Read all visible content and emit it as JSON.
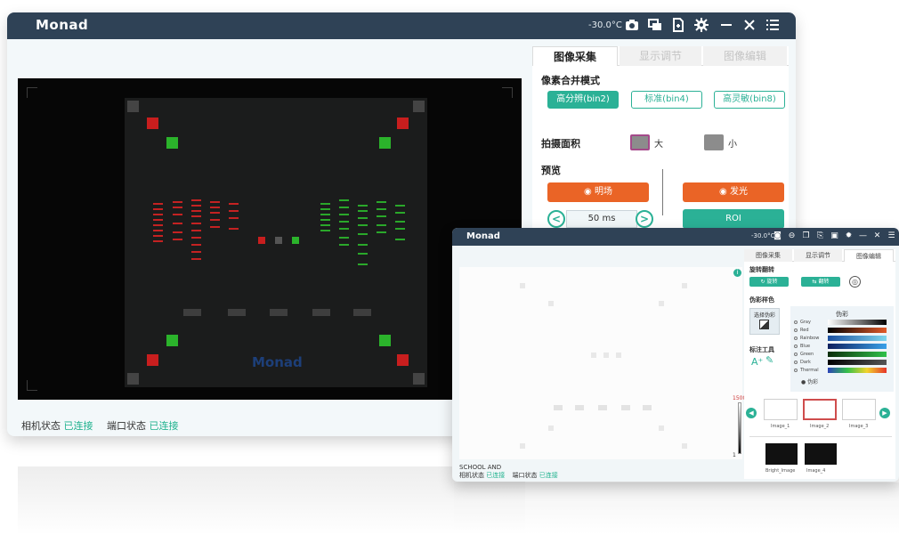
{
  "main_window": {
    "title": "Monad",
    "temperature": "-30.0°C",
    "icons": [
      "camera-icon",
      "windows-icon",
      "export-icon",
      "gear-icon",
      "minimize-icon",
      "close-icon",
      "list-icon"
    ],
    "tabs": [
      {
        "label": "图像采集",
        "active": true
      },
      {
        "label": "显示调节",
        "active": false
      },
      {
        "label": "图像编辑",
        "active": false
      }
    ],
    "binning": {
      "title": "像素合并模式",
      "options": [
        {
          "label": "高分辨(bin2)",
          "active": true
        },
        {
          "label": "标准(bin4)",
          "active": false
        },
        {
          "label": "高灵敏(bin8)",
          "active": false
        }
      ]
    },
    "area": {
      "title": "拍摄面积",
      "large": "大",
      "small": "小"
    },
    "preview": {
      "title": "预览",
      "brightfield": "明场",
      "chemi": "发光",
      "exposure": "50 ms",
      "roi": "ROI",
      "minus": "<",
      "plus": ">"
    },
    "plate_logo": "Monad",
    "status": {
      "camera_label": "相机状态",
      "camera_value": "已连接",
      "port_label": "端口状态",
      "port_value": "已连接"
    }
  },
  "second_window": {
    "title": "Monad",
    "temperature": "-30.0°C",
    "tabs": [
      {
        "label": "图像采集",
        "active": false
      },
      {
        "label": "显示调节",
        "active": false
      },
      {
        "label": "图像编辑",
        "active": true
      }
    ],
    "section_transform": "旋转翻转",
    "btn_rotate": "↻ 旋转",
    "btn_flip": "⇆ 翻转",
    "section_palette": "伪彩样色",
    "palette_mode": "选择伪彩",
    "palette_header": "伪彩",
    "palette_items": [
      {
        "name": "Gray",
        "colors": "#ffffff,#000000"
      },
      {
        "name": "Red",
        "colors": "#000000,#e25b2a"
      },
      {
        "name": "Rainbow",
        "colors": "#1b4fa0,#7fd7ee"
      },
      {
        "name": "Blue",
        "colors": "#0d1f5e,#39a0e8"
      },
      {
        "name": "Green",
        "colors": "#0b2d0b,#2fc14a"
      },
      {
        "name": "Dark",
        "colors": "#000000,#555555"
      },
      {
        "name": "Thermal",
        "colors": "#2c43b8,#35c04a,#f2d32d,#e6332a"
      }
    ],
    "palette_selected": "● 伪彩",
    "section_tools": "标注工具",
    "tool_text": "A⁺",
    "tool_marker": "✎",
    "colorbar_max": "1500",
    "colorbar_min": "1",
    "thumbs": [
      "Image_1",
      "Image_2",
      "Image_3"
    ],
    "dark_thumbs": [
      "Bright_Image",
      "Image_4"
    ],
    "status": {
      "line1": "SCHOOL AND",
      "camera_label": "相机状态",
      "camera_value": "已连接",
      "port_label": "端口状态",
      "port_value": "已连接"
    }
  }
}
